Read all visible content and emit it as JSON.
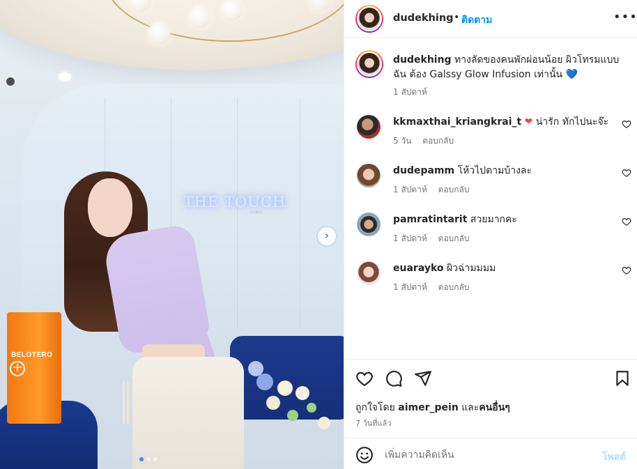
{
  "header": {
    "username": "dudekhing",
    "separator": "•",
    "follow_label": "ติดตาม",
    "more_label": "•••"
  },
  "photo": {
    "brand_text": "THE TOUCH",
    "brand_sub": "CLINIC",
    "box_label": "BELOTERO",
    "next_label": "›",
    "carousel_dots": 3,
    "active_dot": 1
  },
  "caption": {
    "username": "dudekhing",
    "text": "ทางลัดของคนพักผ่อนน้อย ผิวโทรมแบบฉัน ต้อง Galssy Glow Infusion เท่านั้น",
    "emoji": "💙",
    "time": "1 สัปดาห์"
  },
  "comments": [
    {
      "username": "kkmaxthai_kriangkrai_t",
      "text": "น่ารัก ทักไปนะจ๊ะ",
      "heart": "❤",
      "time": "5 วัน",
      "reply_label": "ตอบกลับ"
    },
    {
      "username": "dudepamm",
      "text": "โห้วไปตามบ้างละ",
      "time": "1 สัปดาห์",
      "reply_label": "ตอบกลับ"
    },
    {
      "username": "pamratintarit",
      "text": "สวยมากคะ",
      "time": "1 สัปดาห์",
      "reply_label": "ตอบกลับ"
    },
    {
      "username": "euarayko",
      "text": "ผิวฉ่ามมมม",
      "time": "1 สัปดาห์",
      "reply_label": "ตอบกลับ"
    }
  ],
  "actions": {
    "icons": [
      "heart-icon",
      "comment-icon",
      "share-icon",
      "bookmark-icon"
    ],
    "likes_prefix": "ถูกใจโดย",
    "likes_user": "aimer_pein",
    "likes_conj": "และ",
    "likes_others": "คนอื่นๆ",
    "post_time": "7 วันที่แล้ว"
  },
  "add_comment": {
    "placeholder": "เพิ่มความคิดเห็น",
    "post_label": "โพสต์"
  },
  "colors": {
    "accent": "#0095f6",
    "muted": "#737373",
    "post_disabled": "#b2dffc",
    "heart_red": "#ed4956"
  }
}
